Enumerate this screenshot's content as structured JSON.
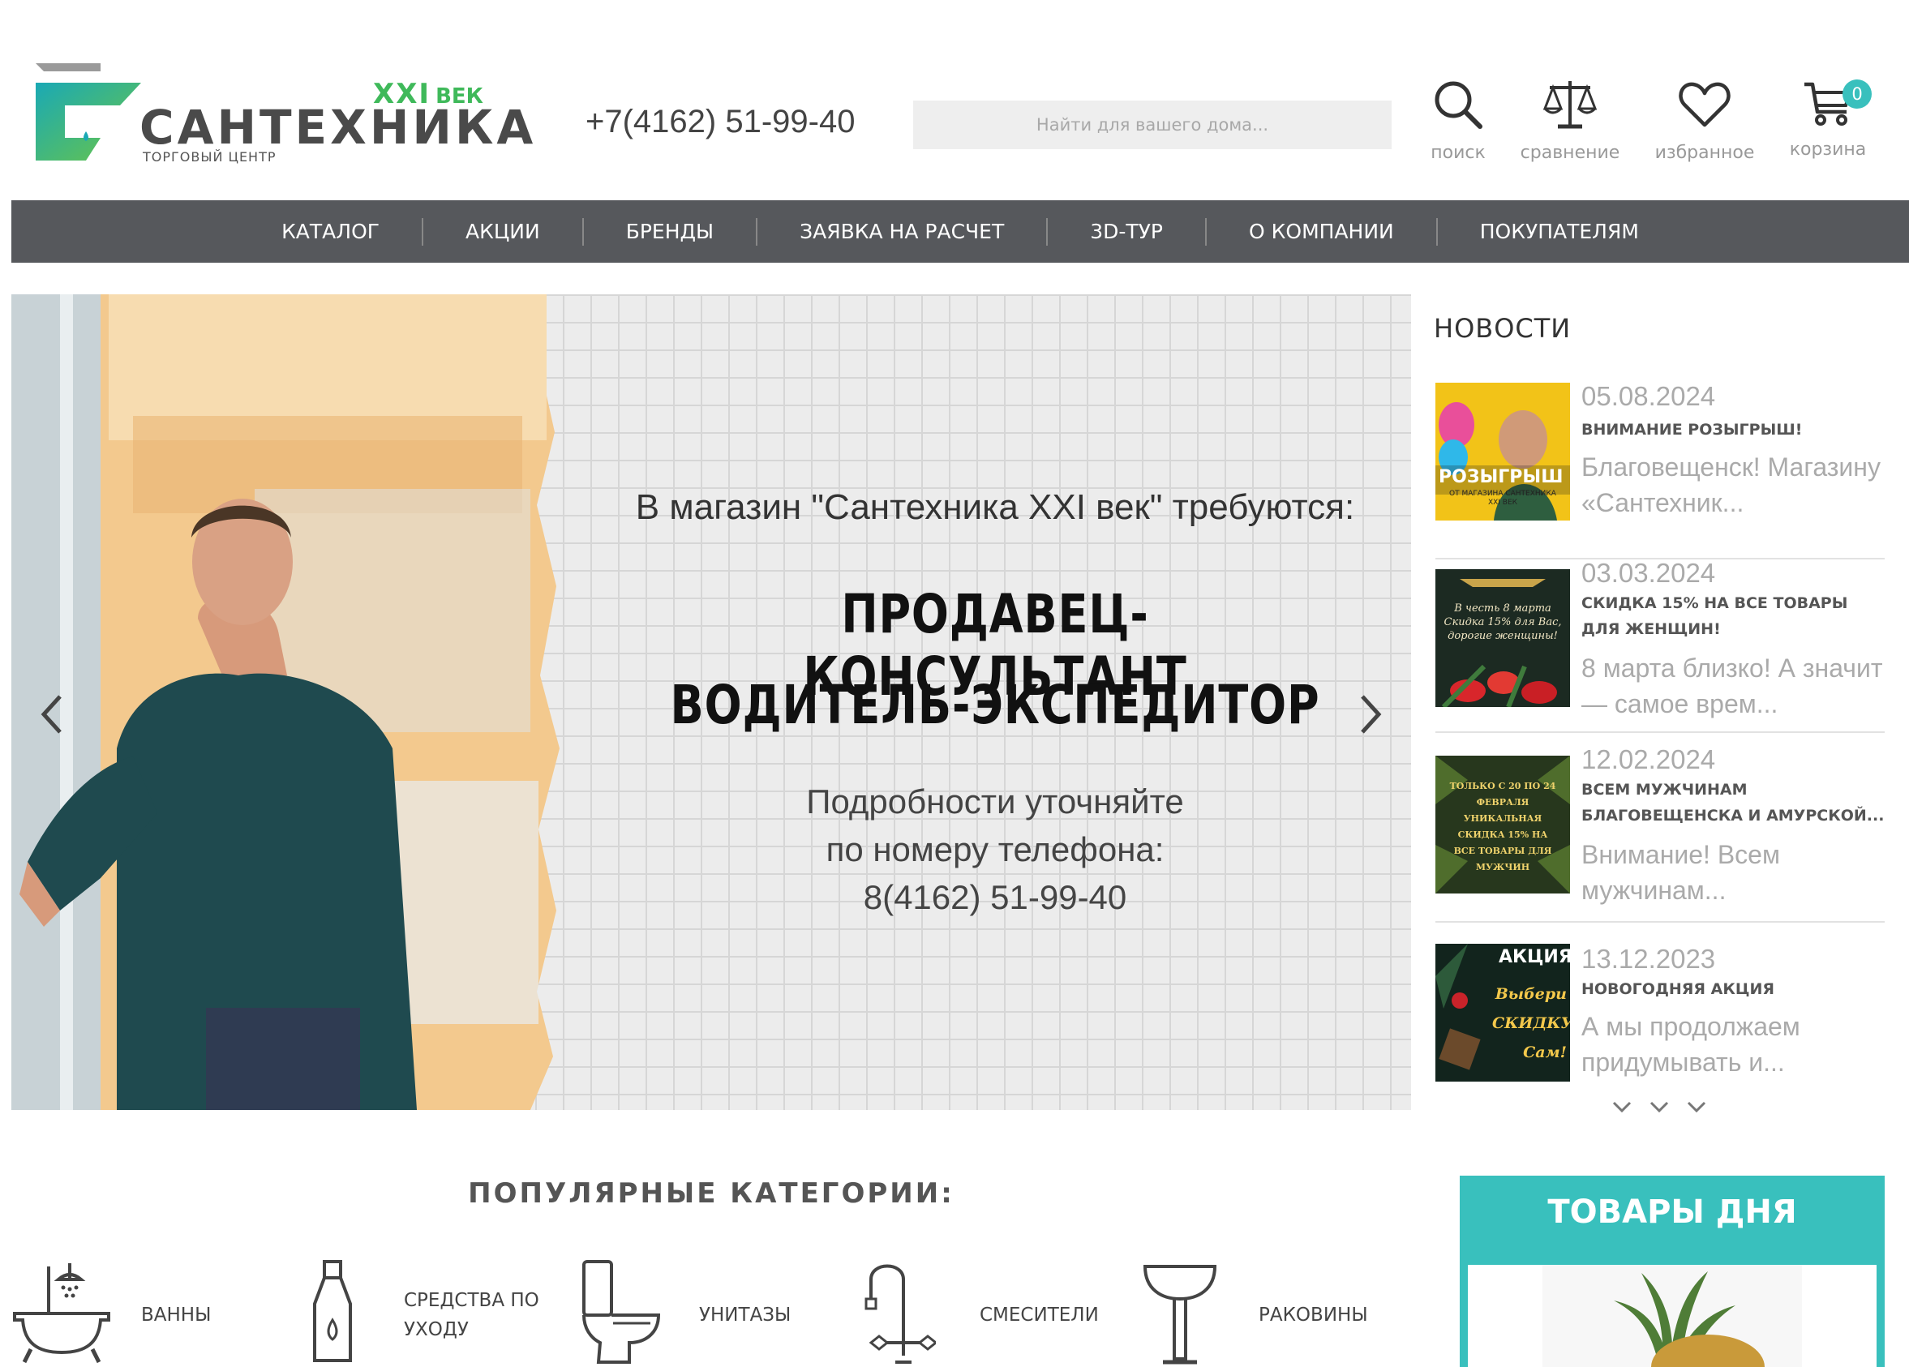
{
  "header": {
    "logo": {
      "xxi": "XXI",
      "vek": "ВЕК",
      "main": "САНТЕХНИКА",
      "sub": "ТОРГОВЫЙ ЦЕНТР"
    },
    "phone": "+7(4162) 51-99-40",
    "search_placeholder": "Найти для вашего дома...",
    "icons": {
      "search": "поиск",
      "compare": "сравнение",
      "favorites": "избранное",
      "cart": "корзина",
      "cart_count": "0"
    }
  },
  "nav": {
    "items": [
      "КАТАЛОГ",
      "АКЦИИ",
      "БРЕНДЫ",
      "ЗАЯВКА НА РАСЧЕТ",
      "3D-ТУР",
      "О КОМПАНИИ",
      "ПОКУПАТЕЛЯМ"
    ]
  },
  "slider": {
    "line1": "В магазин \"Сантехника XXI век\" требуются:",
    "title1": "ПРОДАВЕЦ-КОНСУЛЬТАНТ",
    "title2": "ВОДИТЕЛЬ-ЭКСПЕДИТОР",
    "details1": "Подробности уточняйте",
    "details2": "по номеру телефона:",
    "details3": "8(4162) 51-99-40"
  },
  "news": {
    "heading": "НОВОСТИ",
    "items": [
      {
        "date": "05.08.2024",
        "title": "ВНИМАНИЕ РОЗЫГРЫШ!",
        "desc": "Благовещенск! Магазину «Сантехник...",
        "thumb_text": "РОЗЫГРЫШ",
        "thumb_sub": "ОТ МАГАЗИНА САНТЕХНИКА XXI ВЕК"
      },
      {
        "date": "03.03.2024",
        "title": "СКИДКА 15% НА ВСЕ ТОВАРЫ ДЛЯ ЖЕНЩИН!",
        "desc": "8 марта близко! А значит — самое врем...",
        "thumb_text": "В честь 8 марта Скидка 15% для Вас, дорогие женщины!"
      },
      {
        "date": "12.02.2024",
        "title": "ВСЕМ МУЖЧИНАМ БЛАГОВЕЩЕНСКА И АМУРСКОЙ...",
        "desc": "Внимание! Всем мужчинам...",
        "thumb_text": "ТОЛЬКО С 20 ПО 24 ФЕВРАЛЯ УНИКАЛЬНАЯ СКИДКА 15% НА ВСЕ ТОВАРЫ ДЛЯ МУЖЧИН"
      },
      {
        "date": "13.12.2023",
        "title": "НОВОГОДНЯЯ АКЦИЯ",
        "desc": "А мы продолжаем придумывать и...",
        "thumb_text": "АКЦИЯ",
        "thumb_sub": "Выбери СКИДКУ Сам!"
      }
    ]
  },
  "popular": {
    "heading": "ПОПУЛЯРНЫЕ КАТЕГОРИИ:",
    "categories": [
      "ВАННЫ",
      "СРЕДСТВА ПО",
      "УХОДУ",
      "УНИТАЗЫ",
      "СМЕСИТЕЛИ",
      "РАКОВИНЫ"
    ]
  },
  "products_of_day": {
    "title": "ТОВАРЫ ДНЯ"
  },
  "colors": {
    "accent": "#39c0bd",
    "nav_bg": "#56585c",
    "logo_green": "#3fb95a"
  }
}
